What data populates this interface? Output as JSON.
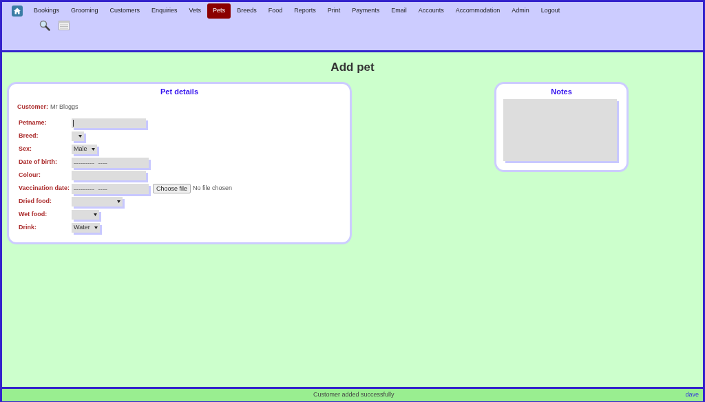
{
  "nav": [
    {
      "label": "Bookings",
      "selected": false
    },
    {
      "label": "Grooming",
      "selected": false
    },
    {
      "label": "Customers",
      "selected": false
    },
    {
      "label": "Enquiries",
      "selected": false
    },
    {
      "label": "Vets",
      "selected": false
    },
    {
      "label": "Pets",
      "selected": true
    },
    {
      "label": "Breeds",
      "selected": false
    },
    {
      "label": "Food",
      "selected": false
    },
    {
      "label": "Reports",
      "selected": false
    },
    {
      "label": "Print",
      "selected": false
    },
    {
      "label": "Payments",
      "selected": false
    },
    {
      "label": "Email",
      "selected": false
    },
    {
      "label": "Accounts",
      "selected": false
    },
    {
      "label": "Accommodation",
      "selected": false
    },
    {
      "label": "Admin",
      "selected": false
    },
    {
      "label": "Logout",
      "selected": false
    }
  ],
  "page_title": "Add pet",
  "pet_details": {
    "title": "Pet details",
    "customer_label": "Customer:",
    "customer": "Mr Bloggs",
    "fields": [
      {
        "label": "Petname:",
        "kind": "text",
        "focused": true
      },
      {
        "label": "Breed:",
        "kind": "select"
      },
      {
        "label": "Sex:",
        "kind": "select",
        "value": "Male"
      },
      {
        "label": "Date of birth:",
        "kind": "date",
        "placeholder": "---------  ----"
      },
      {
        "label": "Colour:",
        "kind": "text"
      },
      {
        "label": "Vaccination date:",
        "kind": "date",
        "placeholder": "---------  ----",
        "file_button": "Choose file",
        "file_status": "No file chosen"
      },
      {
        "label": "Dried food:",
        "kind": "select"
      },
      {
        "label": "Wet food:",
        "kind": "select"
      },
      {
        "label": "Drink:",
        "kind": "select",
        "value": "Water"
      }
    ]
  },
  "notes": {
    "title": "Notes"
  },
  "status_bar": {
    "message": "Customer added successfully",
    "user": "dave"
  }
}
